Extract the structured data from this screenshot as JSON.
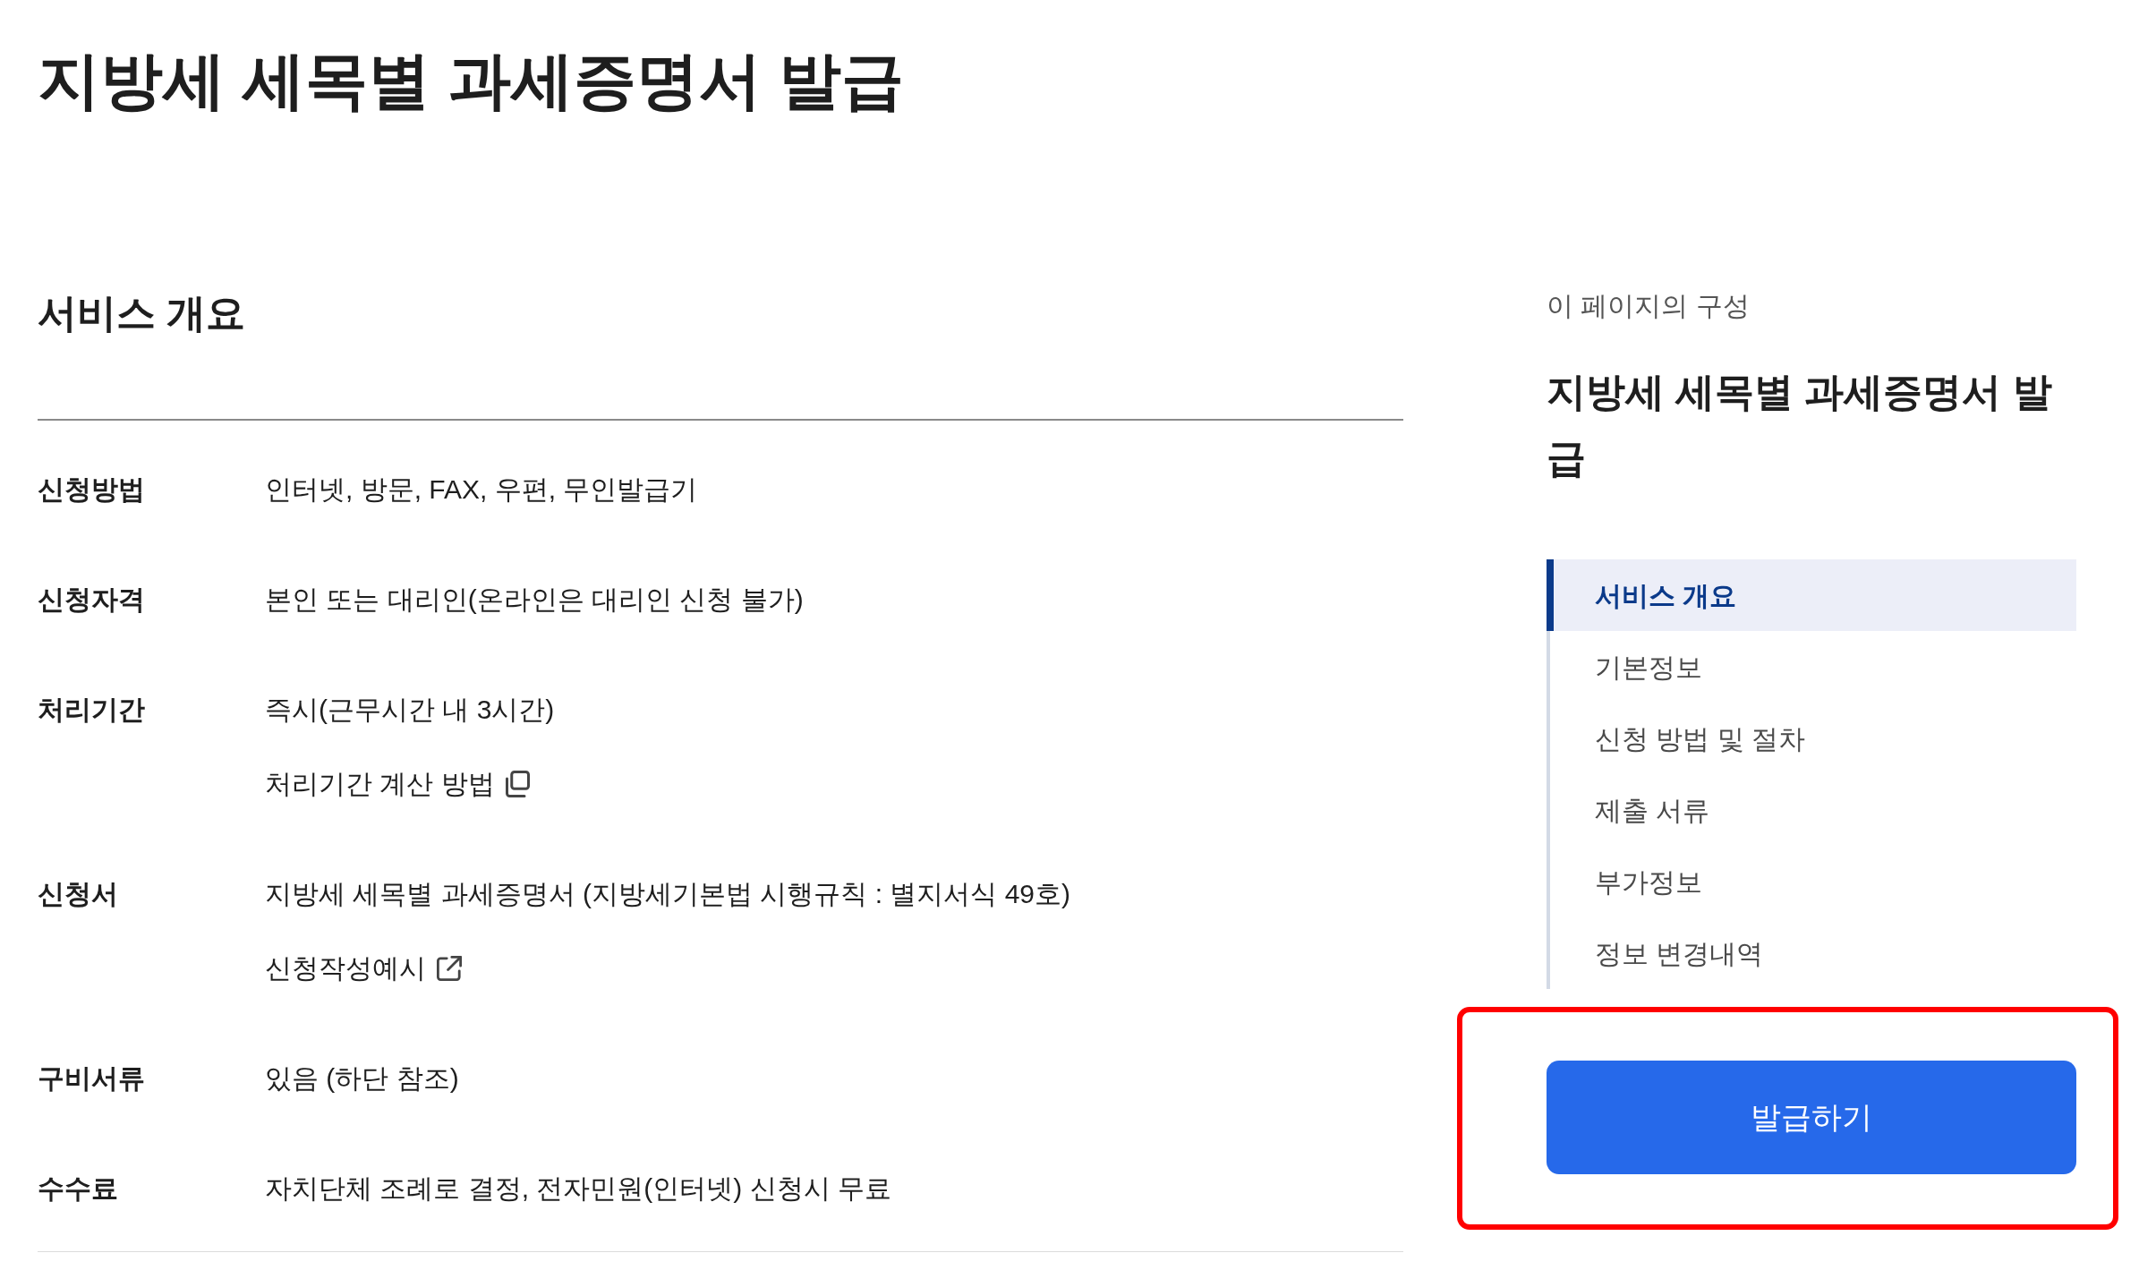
{
  "page_title": "지방세 세목별 과세증명서 발급",
  "service_overview": {
    "title": "서비스 개요",
    "rows": [
      {
        "label": "신청방법",
        "lines": [
          {
            "kind": "text",
            "text": "인터넷, 방문, FAX, 우편, 무인발급기"
          }
        ]
      },
      {
        "label": "신청자격",
        "lines": [
          {
            "kind": "text",
            "text": "본인 또는 대리인(온라인은 대리인 신청 불가)"
          }
        ]
      },
      {
        "label": "처리기간",
        "lines": [
          {
            "kind": "text",
            "text": "즉시(근무시간 내 3시간)"
          },
          {
            "kind": "popup_link",
            "text": "처리기간 계산 방법"
          }
        ]
      },
      {
        "label": "신청서",
        "lines": [
          {
            "kind": "text",
            "text": "지방세 세목별 과세증명서 (지방세기본법 시행규칙 : 별지서식 49호)"
          },
          {
            "kind": "external_link",
            "text": "신청작성예시"
          }
        ]
      },
      {
        "label": "구비서류",
        "lines": [
          {
            "kind": "text",
            "text": "있음 (하단 참조)"
          }
        ]
      },
      {
        "label": "수수료",
        "lines": [
          {
            "kind": "text",
            "text": "자치단체 조례로 결정, 전자민원(인터넷) 신청시 무료"
          }
        ]
      }
    ]
  },
  "sidebar": {
    "caption": "이 페이지의 구성",
    "title": "지방세 세목별 과세증명서 발급",
    "nav": [
      {
        "label": "서비스 개요",
        "selected": true
      },
      {
        "label": "기본정보",
        "selected": false
      },
      {
        "label": "신청 방법 및 절차",
        "selected": false
      },
      {
        "label": "제출 서류",
        "selected": false
      },
      {
        "label": "부가정보",
        "selected": false
      },
      {
        "label": "정보 변경내역",
        "selected": false
      }
    ],
    "action_button": {
      "label": "발급하기",
      "highlighted": true
    }
  }
}
